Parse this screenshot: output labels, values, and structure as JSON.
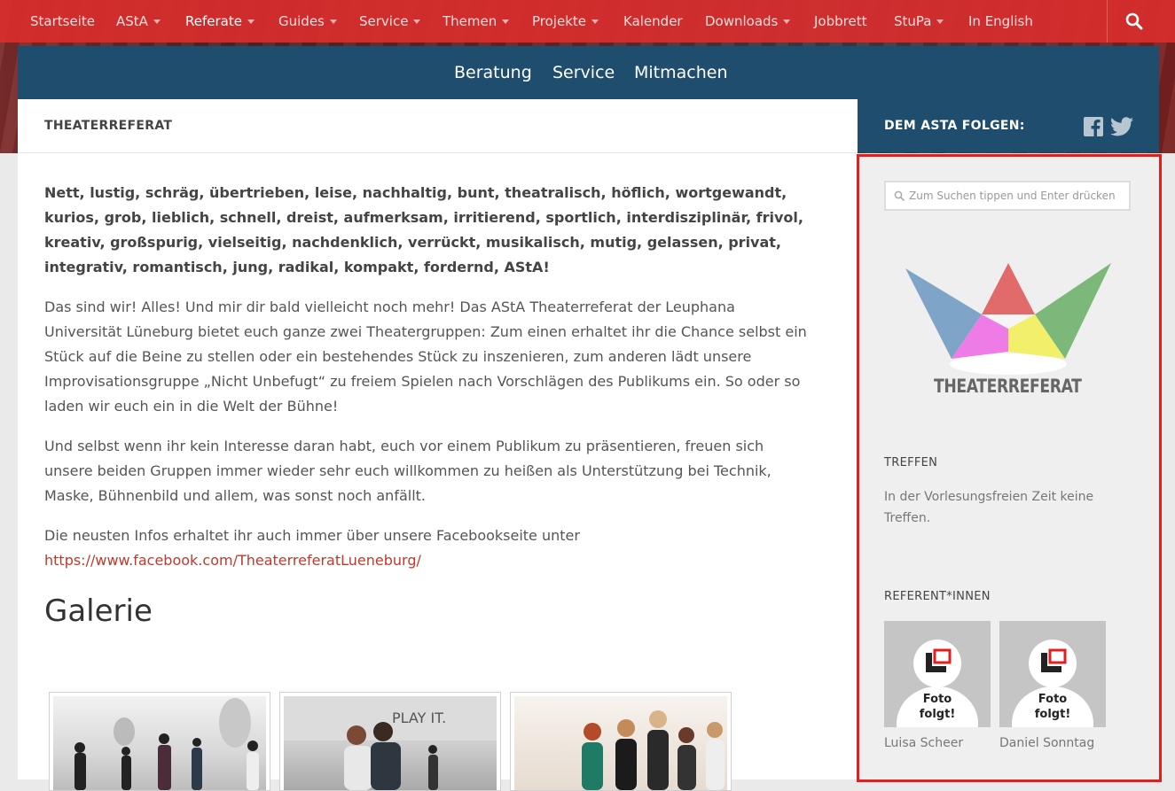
{
  "top_nav": {
    "items": [
      {
        "label": "Startseite"
      },
      {
        "label": "AStA"
      },
      {
        "label": "Referate"
      },
      {
        "label": "Guides"
      },
      {
        "label": "Service"
      },
      {
        "label": "Themen"
      },
      {
        "label": "Projekte"
      },
      {
        "label": "Kalender"
      },
      {
        "label": "Downloads"
      },
      {
        "label": "Jobbrett"
      },
      {
        "label": "StuPa"
      },
      {
        "label": "In English"
      }
    ],
    "active": "Referate",
    "search_icon": "search-icon"
  },
  "sub_nav": {
    "items": [
      {
        "label": "Beratung"
      },
      {
        "label": "Service"
      },
      {
        "label": "Mitmachen"
      }
    ]
  },
  "page": {
    "title": "THEATERREFERAT",
    "lead": "Nett, lustig, schräg, übertrieben, leise, nachhaltig, bunt, theatralisch, höflich, wortgewandt, kurios, grob, lieblich, schnell, dreist, aufmerksam, irritierend, sportlich, interdisziplinär, frivol, kreativ, großspurig, vielseitig, nachdenklich, verrückt, musikalisch, mutig, gelassen, privat, integrativ, romantisch, jung, radikal, kompakt, fordernd, AStA!",
    "para1": "Das sind wir! Alles! Und mir dir bald vielleicht noch mehr! Das AStA Theaterreferat der Leuphana Universität Lüneburg bietet euch ganze zwei Theatergruppen: Zum einen erhaltet ihr die Chance selbst ein Stück auf die Beine zu stellen oder ein bestehendes Stück zu inszenieren, zum anderen lädt unsere Improvisationsgruppe „Nicht Unbefugt“ zu freiem Spielen nach Vorschlägen des Publikums ein. So oder so laden wir euch ein in die Welt der Bühne!",
    "para2": "Und selbst wenn ihr kein Interesse daran habt, euch vor einem Publikum zu präsentieren, freuen sich unsere beiden Gruppen immer wieder sehr euch willkommen zu heißen als Unterstützung bei Technik, Maske, Bühnenbild und allem, was sonst noch anfällt.",
    "para3": "Die neusten Infos erhaltet ihr auch immer über unsere Facebookseite unter",
    "link": "https://www.facebook.com/TheaterreferatLueneburg/",
    "gallery_title": "Galerie",
    "gallery_banner_text": "PLAY IT."
  },
  "sidebar": {
    "follow_label": "DEM ASTA FOLGEN:",
    "search_placeholder": "Zum Suchen tippen und Enter drücken",
    "logo_text": "THEATERREFERAT",
    "treffen_title": "TREFFEN",
    "treffen_text": "In der Vorlesungsfreien Zeit keine Treffen.",
    "referent_title": "REFERENT*INNEN",
    "people": [
      {
        "name": "Luisa Scheer",
        "placeholder": "Foto folgt!"
      },
      {
        "name": "Daniel Sonntag",
        "placeholder": "Foto folgt!"
      }
    ]
  },
  "colors": {
    "nav_red": "#d82d2d",
    "nav_blue": "#1e4d6e",
    "link_red": "#c0392b",
    "highlight_border": "#e0201e"
  }
}
